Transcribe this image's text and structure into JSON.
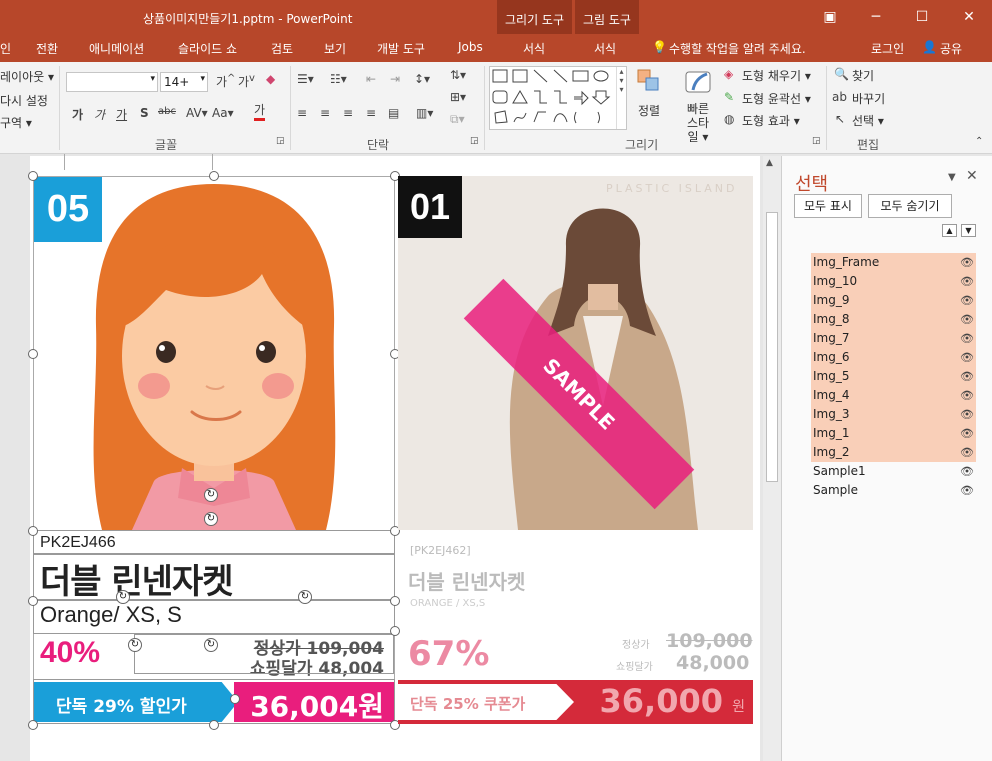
{
  "titlebar": {
    "title": "상품이미지만들기1.pptm - PowerPoint",
    "context_groups": [
      "그리기 도구",
      "그림 도구"
    ]
  },
  "tabs": [
    "인",
    "전환",
    "애니메이션",
    "슬라이드 쇼",
    "검토",
    "보기",
    "개발 도구",
    "Jobs",
    "서식",
    "서식"
  ],
  "tellme": "수행할 작업을 알려 주세요.",
  "login": "로그인",
  "share": "공유",
  "ribbon": {
    "slides_group": [
      "레이아웃 ▾",
      "다시 설정",
      "구역 ▾"
    ],
    "font_size": "14+",
    "font_group_label": "글꼴",
    "paragraph_group_label": "단락",
    "drawing_group_label": "그리기",
    "edit_group_label": "편집",
    "arrange_label": "정렬",
    "quick_style_label": "빠른 스타일 ▾",
    "shape_fill": "도형 채우기 ▾",
    "shape_outline": "도형 윤곽선 ▾",
    "shape_effect": "도형 효과 ▾",
    "find": "찾기",
    "replace": "바꾸기",
    "select": "선택 ▾",
    "font_buttons": [
      "가",
      "가",
      "가",
      "S",
      "가"
    ]
  },
  "card1": {
    "badge": "05",
    "code": "PK2EJ466",
    "name": "더블 린넨자켓",
    "option": "Orange/ XS, S",
    "discount": "40%",
    "regular": "정상가 109,004",
    "shopping": "쇼핑달가 48,004",
    "banner": "단독 29% 할인가",
    "price": "36,004원"
  },
  "card2": {
    "badge": "01",
    "brand": "PLASTIC ISLAND",
    "sample": "SAMPLE",
    "code": "[PK2EJ462]",
    "name": "더블 린넨자켓",
    "option": "ORANGE / XS,S",
    "discount": "67%",
    "regular_label": "정상가",
    "regular": "109,000",
    "shopping_label": "쇼핑달가",
    "shopping": "48,000",
    "banner": "단독 25% 쿠폰가",
    "price": "36,000",
    "unit": "원"
  },
  "selection_pane": {
    "title": "선택",
    "show_all": "모두 표시",
    "hide_all": "모두 숨기기",
    "layers": [
      "Img_Frame",
      "Img_10",
      "Img_9",
      "Img_8",
      "Img_7",
      "Img_6",
      "Img_5",
      "Img_4",
      "Img_3",
      "Img_1",
      "Img_2",
      "Sample1",
      "Sample"
    ],
    "highlight_color": "#f9cfb8"
  },
  "colors": {
    "accent": "#b7472a",
    "blue": "#1a9fd9",
    "pink": "#e91e7d",
    "red": "#d42a3a"
  }
}
